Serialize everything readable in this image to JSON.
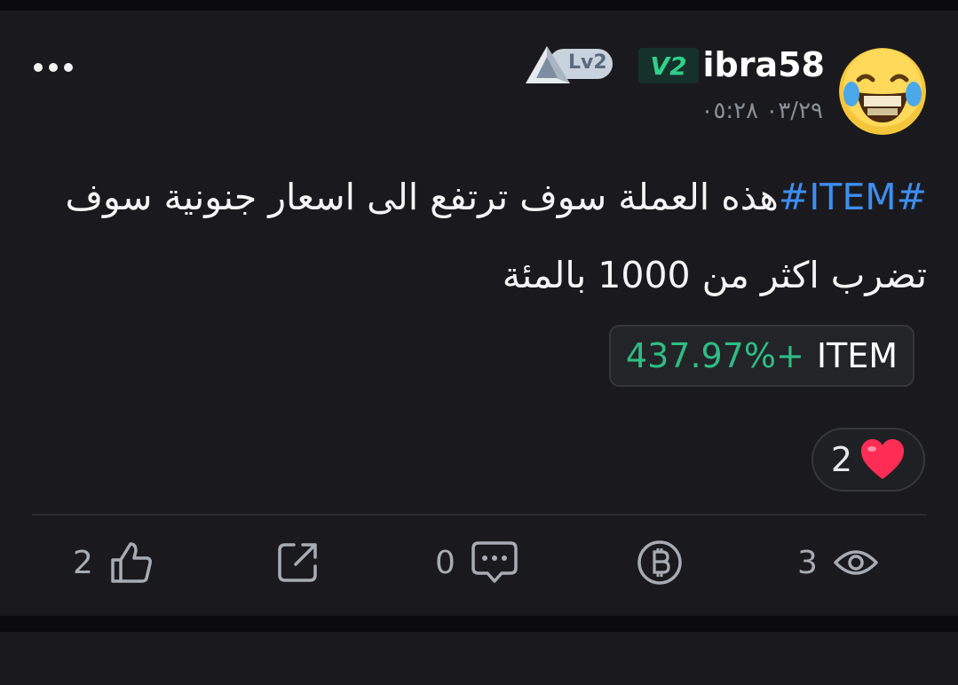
{
  "post": {
    "username": "ibra58",
    "vip_badge": "V2",
    "level_badge": "Lv2",
    "timestamp": "٠٣/٢٩ ٠٥:٢٨",
    "hashtag": "#ITEM#",
    "text_line1": "هذه العملة سوف ترتفع الى اسعار جنونية سوف",
    "text_line2": "تضرب اكثر من 1000 بالمئة",
    "ticker": {
      "symbol": "ITEM",
      "change": "+437.97%"
    },
    "reaction_count": "2"
  },
  "actions": {
    "likes": "2",
    "comments": "0",
    "views": "3"
  },
  "colors": {
    "background": "#1a1a1e",
    "hashtag": "#3d8ef0",
    "positive": "#2ebd85",
    "vip": "#2fd08b"
  },
  "icons": [
    "more-icon",
    "level-triangle-icon",
    "heart-icon",
    "thumbs-up-icon",
    "share-icon",
    "comment-icon",
    "tip-coin-icon",
    "eye-icon"
  ]
}
